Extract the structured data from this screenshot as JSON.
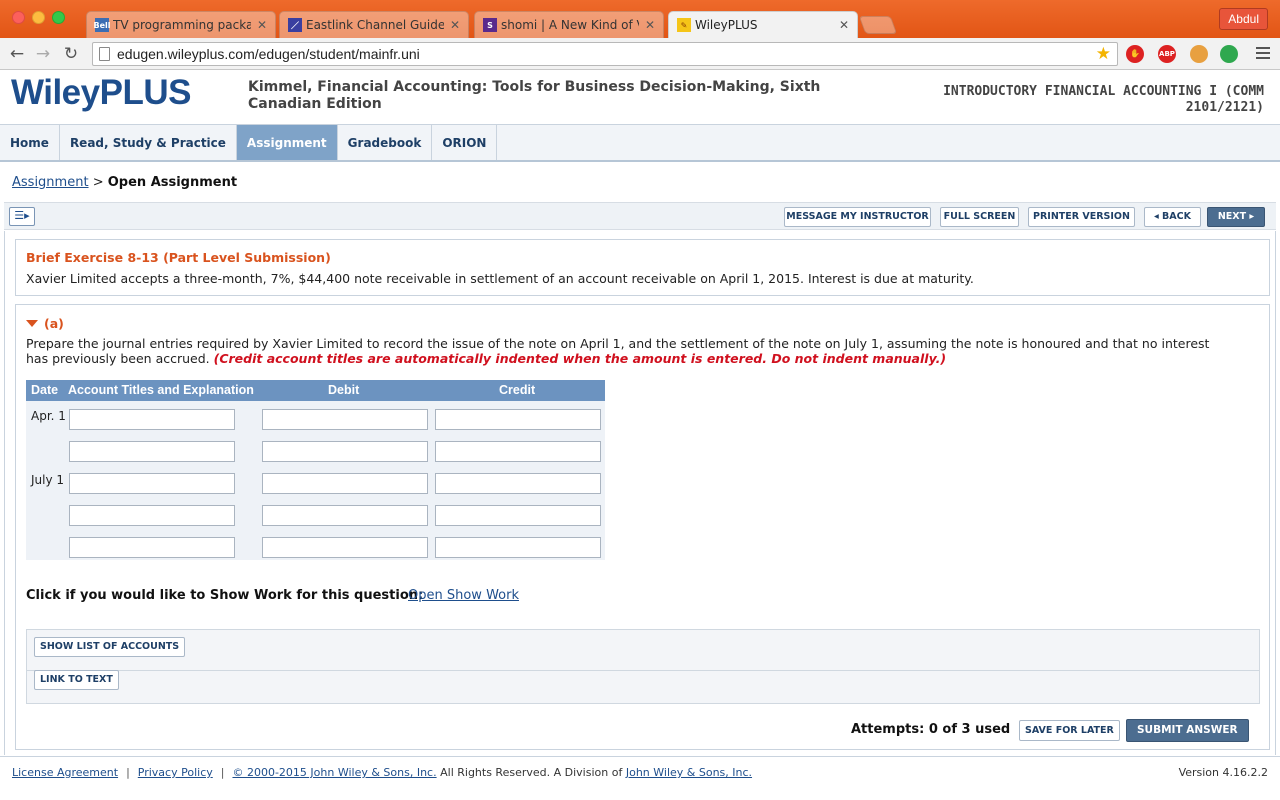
{
  "browser": {
    "user_label": "Abdul",
    "url": "edugen.wileyplus.com/edugen/student/mainfr.uni",
    "tabs": [
      {
        "title": "TV programming packages",
        "favicon": "Bell",
        "color": "#3b6db3"
      },
      {
        "title": "Eastlink Channel Guide – E",
        "favicon": "",
        "color": "#3a3fa0"
      },
      {
        "title": "shomi | A New Kind of Vide",
        "favicon": "S",
        "color": "#5a2a8c"
      },
      {
        "title": "WileyPLUS",
        "favicon": "",
        "color": "#f5c518"
      }
    ],
    "extensions": {
      "abp": "ABP",
      "off": "off",
      "new": "NEW"
    }
  },
  "header": {
    "logo": "WileyPLUS",
    "book_title": "Kimmel, Financial Accounting: Tools for Business Decision-Making, Sixth Canadian Edition",
    "course_title": "INTRODUCTORY FINANCIAL ACCOUNTING I (COMM 2101/2121)"
  },
  "nav": {
    "items": [
      "Home",
      "Read, Study & Practice",
      "Assignment",
      "Gradebook",
      "ORION"
    ],
    "active": "Assignment"
  },
  "breadcrumb": {
    "link": "Assignment",
    "separator": ">",
    "current": "Open Assignment"
  },
  "actions": {
    "message": "MESSAGE MY INSTRUCTOR",
    "fullscreen": "FULL SCREEN",
    "printer": "PRINTER VERSION",
    "back": "◂ BACK",
    "next": "NEXT ▸"
  },
  "question": {
    "title": "Brief Exercise 8-13 (Part Level Submission)",
    "text": "Xavier Limited accepts a three-month, 7%, $44,400 note receivable in settlement of an account receivable on April 1, 2015. Interest is due at maturity."
  },
  "part": {
    "label": "(a)",
    "instructions": "Prepare the journal entries required by Xavier Limited to record the issue of the note on April 1, and the settlement of the note on July 1, assuming the note is honoured and that no interest has previously been accrued.",
    "note": "(Credit account titles are automatically indented when the amount is entered. Do not indent manually.)"
  },
  "journal": {
    "headers": {
      "date": "Date",
      "account": "Account Titles and Explanation",
      "debit": "Debit",
      "credit": "Credit"
    },
    "dates": [
      "Apr. 1",
      "July 1"
    ]
  },
  "show_work": {
    "prompt": "Click if you would like to Show Work for this question:",
    "link": "Open Show Work"
  },
  "tools": {
    "accounts": "SHOW LIST OF ACCOUNTS",
    "link_text": "LINK TO TEXT"
  },
  "submission": {
    "attempts": "Attempts: 0 of 3 used",
    "save": "SAVE FOR LATER",
    "submit": "SUBMIT ANSWER"
  },
  "footer": {
    "license": "License Agreement",
    "privacy": "Privacy Policy",
    "copyright_link": "© 2000-2015 John Wiley & Sons, Inc.",
    "rights": "All Rights Reserved. A Division of",
    "company": "John Wiley & Sons, Inc.",
    "version": "Version 4.16.2.2"
  }
}
